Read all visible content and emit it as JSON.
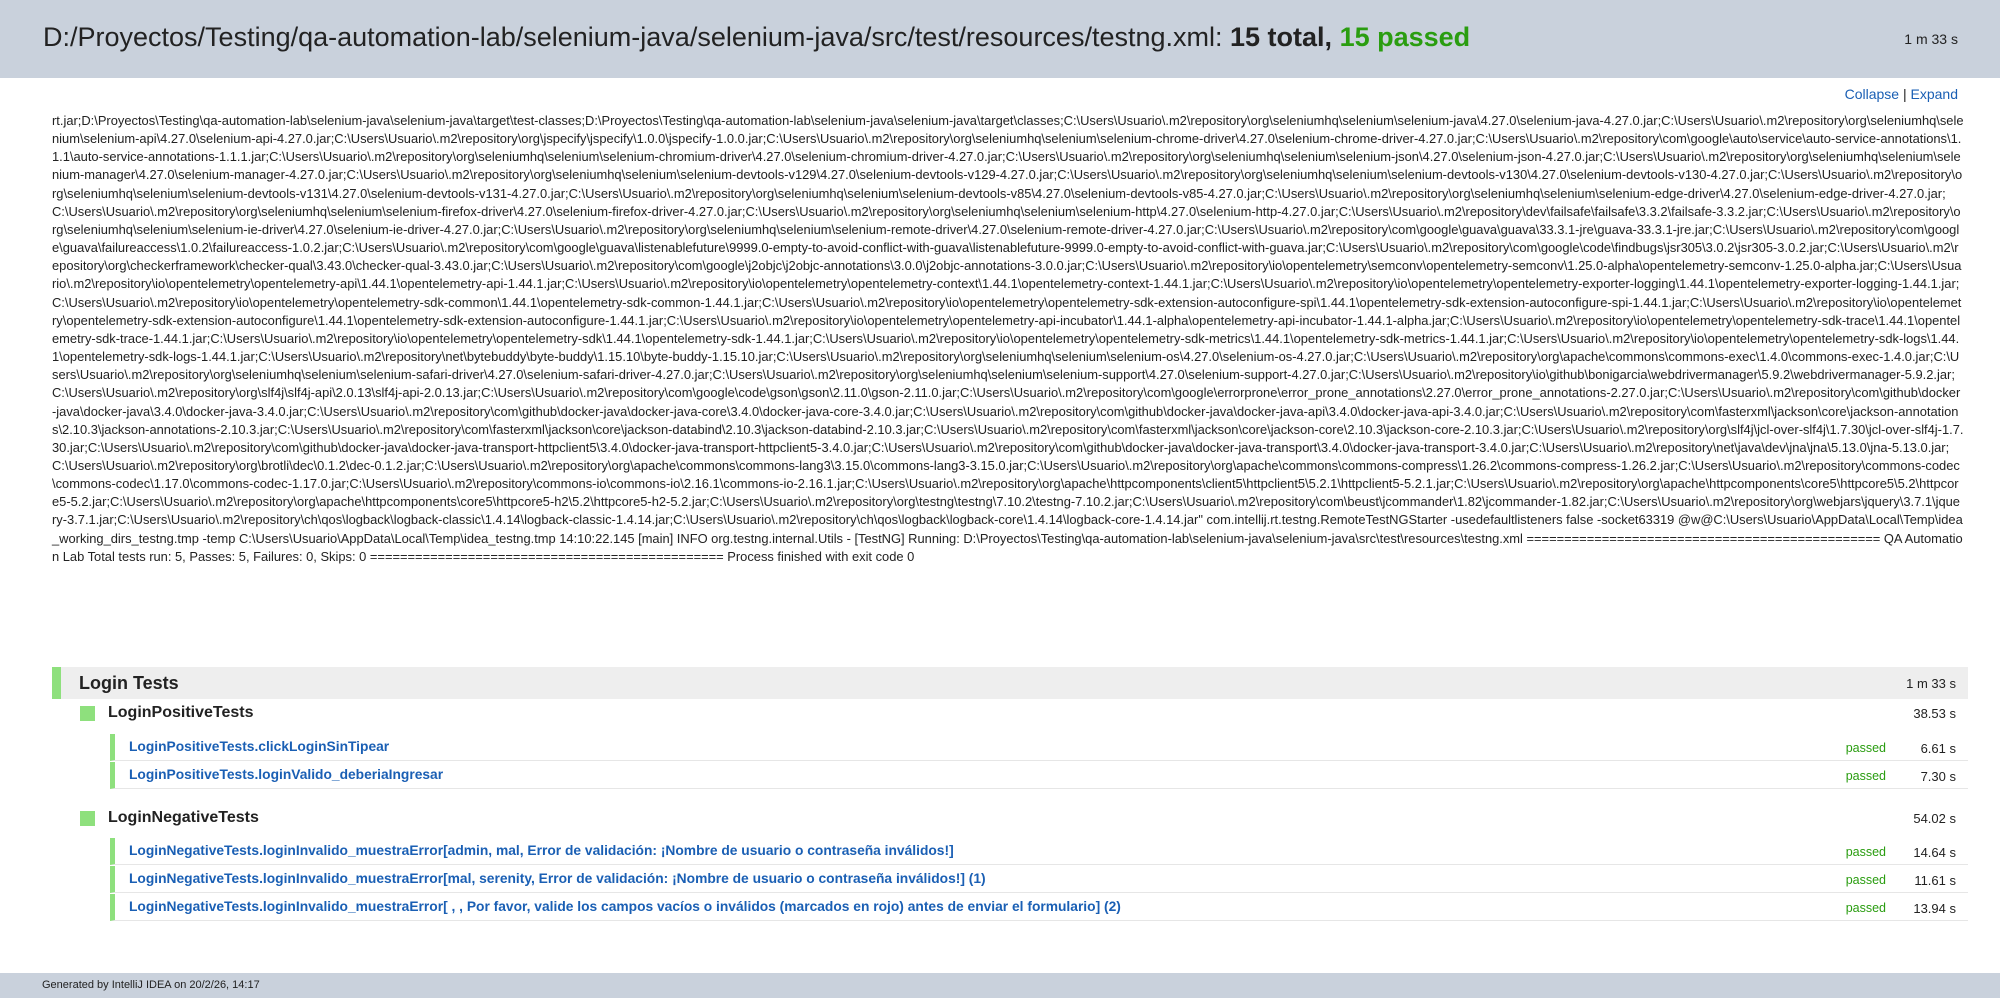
{
  "header": {
    "path": "D:/Proyectos/Testing/qa-automation-lab/selenium-java/selenium-java/src/test/resources/testng.xml:",
    "total": "15 total,",
    "passed": "15 passed",
    "duration": "1 m 33 s"
  },
  "toolbar": {
    "collapse": "Collapse",
    "separator": "|",
    "expand": "Expand"
  },
  "log": "rt.jar;D:\\Proyectos\\Testing\\qa-automation-lab\\selenium-java\\selenium-java\\target\\test-classes;D:\\Proyectos\\Testing\\qa-automation-lab\\selenium-java\\selenium-java\\target\\classes;C:\\Users\\Usuario\\.m2\\repository\\org\\seleniumhq\\selenium\\selenium-java\\4.27.0\\selenium-java-4.27.0.jar;C:\\Users\\Usuario\\.m2\\repository\\org\\seleniumhq\\selenium\\selenium-api\\4.27.0\\selenium-api-4.27.0.jar;C:\\Users\\Usuario\\.m2\\repository\\org\\jspecify\\jspecify\\1.0.0\\jspecify-1.0.0.jar;C:\\Users\\Usuario\\.m2\\repository\\org\\seleniumhq\\selenium\\selenium-chrome-driver\\4.27.0\\selenium-chrome-driver-4.27.0.jar;C:\\Users\\Usuario\\.m2\\repository\\com\\google\\auto\\service\\auto-service-annotations\\1.1.1\\auto-service-annotations-1.1.1.jar;C:\\Users\\Usuario\\.m2\\repository\\org\\seleniumhq\\selenium\\selenium-chromium-driver\\4.27.0\\selenium-chromium-driver-4.27.0.jar;C:\\Users\\Usuario\\.m2\\repository\\org\\seleniumhq\\selenium\\selenium-json\\4.27.0\\selenium-json-4.27.0.jar;C:\\Users\\Usuario\\.m2\\repository\\org\\seleniumhq\\selenium\\selenium-manager\\4.27.0\\selenium-manager-4.27.0.jar;C:\\Users\\Usuario\\.m2\\repository\\org\\seleniumhq\\selenium\\selenium-devtools-v129\\4.27.0\\selenium-devtools-v129-4.27.0.jar;C:\\Users\\Usuario\\.m2\\repository\\org\\seleniumhq\\selenium\\selenium-devtools-v130\\4.27.0\\selenium-devtools-v130-4.27.0.jar;C:\\Users\\Usuario\\.m2\\repository\\org\\seleniumhq\\selenium\\selenium-devtools-v131\\4.27.0\\selenium-devtools-v131-4.27.0.jar;C:\\Users\\Usuario\\.m2\\repository\\org\\seleniumhq\\selenium\\selenium-devtools-v85\\4.27.0\\selenium-devtools-v85-4.27.0.jar;C:\\Users\\Usuario\\.m2\\repository\\org\\seleniumhq\\selenium\\selenium-edge-driver\\4.27.0\\selenium-edge-driver-4.27.0.jar;C:\\Users\\Usuario\\.m2\\repository\\org\\seleniumhq\\selenium\\selenium-firefox-driver\\4.27.0\\selenium-firefox-driver-4.27.0.jar;C:\\Users\\Usuario\\.m2\\repository\\org\\seleniumhq\\selenium\\selenium-http\\4.27.0\\selenium-http-4.27.0.jar;C:\\Users\\Usuario\\.m2\\repository\\dev\\failsafe\\failsafe\\3.3.2\\failsafe-3.3.2.jar;C:\\Users\\Usuario\\.m2\\repository\\org\\seleniumhq\\selenium\\selenium-ie-driver\\4.27.0\\selenium-ie-driver-4.27.0.jar;C:\\Users\\Usuario\\.m2\\repository\\org\\seleniumhq\\selenium\\selenium-remote-driver\\4.27.0\\selenium-remote-driver-4.27.0.jar;C:\\Users\\Usuario\\.m2\\repository\\com\\google\\guava\\guava\\33.3.1-jre\\guava-33.3.1-jre.jar;C:\\Users\\Usuario\\.m2\\repository\\com\\google\\guava\\failureaccess\\1.0.2\\failureaccess-1.0.2.jar;C:\\Users\\Usuario\\.m2\\repository\\com\\google\\guava\\listenablefuture\\9999.0-empty-to-avoid-conflict-with-guava\\listenablefuture-9999.0-empty-to-avoid-conflict-with-guava.jar;C:\\Users\\Usuario\\.m2\\repository\\com\\google\\code\\findbugs\\jsr305\\3.0.2\\jsr305-3.0.2.jar;C:\\Users\\Usuario\\.m2\\repository\\org\\checkerframework\\checker-qual\\3.43.0\\checker-qual-3.43.0.jar;C:\\Users\\Usuario\\.m2\\repository\\com\\google\\j2objc\\j2objc-annotations\\3.0.0\\j2objc-annotations-3.0.0.jar;C:\\Users\\Usuario\\.m2\\repository\\io\\opentelemetry\\semconv\\opentelemetry-semconv\\1.25.0-alpha\\opentelemetry-semconv-1.25.0-alpha.jar;C:\\Users\\Usuario\\.m2\\repository\\io\\opentelemetry\\opentelemetry-api\\1.44.1\\opentelemetry-api-1.44.1.jar;C:\\Users\\Usuario\\.m2\\repository\\io\\opentelemetry\\opentelemetry-context\\1.44.1\\opentelemetry-context-1.44.1.jar;C:\\Users\\Usuario\\.m2\\repository\\io\\opentelemetry\\opentelemetry-exporter-logging\\1.44.1\\opentelemetry-exporter-logging-1.44.1.jar;C:\\Users\\Usuario\\.m2\\repository\\io\\opentelemetry\\opentelemetry-sdk-common\\1.44.1\\opentelemetry-sdk-common-1.44.1.jar;C:\\Users\\Usuario\\.m2\\repository\\io\\opentelemetry\\opentelemetry-sdk-extension-autoconfigure-spi\\1.44.1\\opentelemetry-sdk-extension-autoconfigure-spi-1.44.1.jar;C:\\Users\\Usuario\\.m2\\repository\\io\\opentelemetry\\opentelemetry-sdk-extension-autoconfigure\\1.44.1\\opentelemetry-sdk-extension-autoconfigure-1.44.1.jar;C:\\Users\\Usuario\\.m2\\repository\\io\\opentelemetry\\opentelemetry-api-incubator\\1.44.1-alpha\\opentelemetry-api-incubator-1.44.1-alpha.jar;C:\\Users\\Usuario\\.m2\\repository\\io\\opentelemetry\\opentelemetry-sdk-trace\\1.44.1\\opentelemetry-sdk-trace-1.44.1.jar;C:\\Users\\Usuario\\.m2\\repository\\io\\opentelemetry\\opentelemetry-sdk\\1.44.1\\opentelemetry-sdk-1.44.1.jar;C:\\Users\\Usuario\\.m2\\repository\\io\\opentelemetry\\opentelemetry-sdk-metrics\\1.44.1\\opentelemetry-sdk-metrics-1.44.1.jar;C:\\Users\\Usuario\\.m2\\repository\\io\\opentelemetry\\opentelemetry-sdk-logs\\1.44.1\\opentelemetry-sdk-logs-1.44.1.jar;C:\\Users\\Usuario\\.m2\\repository\\net\\bytebuddy\\byte-buddy\\1.15.10\\byte-buddy-1.15.10.jar;C:\\Users\\Usuario\\.m2\\repository\\org\\seleniumhq\\selenium\\selenium-os\\4.27.0\\selenium-os-4.27.0.jar;C:\\Users\\Usuario\\.m2\\repository\\org\\apache\\commons\\commons-exec\\1.4.0\\commons-exec-1.4.0.jar;C:\\Users\\Usuario\\.m2\\repository\\org\\seleniumhq\\selenium\\selenium-safari-driver\\4.27.0\\selenium-safari-driver-4.27.0.jar;C:\\Users\\Usuario\\.m2\\repository\\org\\seleniumhq\\selenium\\selenium-support\\4.27.0\\selenium-support-4.27.0.jar;C:\\Users\\Usuario\\.m2\\repository\\io\\github\\bonigarcia\\webdrivermanager\\5.9.2\\webdrivermanager-5.9.2.jar;C:\\Users\\Usuario\\.m2\\repository\\org\\slf4j\\slf4j-api\\2.0.13\\slf4j-api-2.0.13.jar;C:\\Users\\Usuario\\.m2\\repository\\com\\google\\code\\gson\\gson\\2.11.0\\gson-2.11.0.jar;C:\\Users\\Usuario\\.m2\\repository\\com\\google\\errorprone\\error_prone_annotations\\2.27.0\\error_prone_annotations-2.27.0.jar;C:\\Users\\Usuario\\.m2\\repository\\com\\github\\docker-java\\docker-java\\3.4.0\\docker-java-3.4.0.jar;C:\\Users\\Usuario\\.m2\\repository\\com\\github\\docker-java\\docker-java-core\\3.4.0\\docker-java-core-3.4.0.jar;C:\\Users\\Usuario\\.m2\\repository\\com\\github\\docker-java\\docker-java-api\\3.4.0\\docker-java-api-3.4.0.jar;C:\\Users\\Usuario\\.m2\\repository\\com\\fasterxml\\jackson\\core\\jackson-annotations\\2.10.3\\jackson-annotations-2.10.3.jar;C:\\Users\\Usuario\\.m2\\repository\\com\\fasterxml\\jackson\\core\\jackson-databind\\2.10.3\\jackson-databind-2.10.3.jar;C:\\Users\\Usuario\\.m2\\repository\\com\\fasterxml\\jackson\\core\\jackson-core\\2.10.3\\jackson-core-2.10.3.jar;C:\\Users\\Usuario\\.m2\\repository\\org\\slf4j\\jcl-over-slf4j\\1.7.30\\jcl-over-slf4j-1.7.30.jar;C:\\Users\\Usuario\\.m2\\repository\\com\\github\\docker-java\\docker-java-transport-httpclient5\\3.4.0\\docker-java-transport-httpclient5-3.4.0.jar;C:\\Users\\Usuario\\.m2\\repository\\com\\github\\docker-java\\docker-java-transport\\3.4.0\\docker-java-transport-3.4.0.jar;C:\\Users\\Usuario\\.m2\\repository\\net\\java\\dev\\jna\\jna\\5.13.0\\jna-5.13.0.jar;C:\\Users\\Usuario\\.m2\\repository\\org\\brotli\\dec\\0.1.2\\dec-0.1.2.jar;C:\\Users\\Usuario\\.m2\\repository\\org\\apache\\commons\\commons-lang3\\3.15.0\\commons-lang3-3.15.0.jar;C:\\Users\\Usuario\\.m2\\repository\\org\\apache\\commons\\commons-compress\\1.26.2\\commons-compress-1.26.2.jar;C:\\Users\\Usuario\\.m2\\repository\\commons-codec\\commons-codec\\1.17.0\\commons-codec-1.17.0.jar;C:\\Users\\Usuario\\.m2\\repository\\commons-io\\commons-io\\2.16.1\\commons-io-2.16.1.jar;C:\\Users\\Usuario\\.m2\\repository\\org\\apache\\httpcomponents\\client5\\httpclient5\\5.2.1\\httpclient5-5.2.1.jar;C:\\Users\\Usuario\\.m2\\repository\\org\\apache\\httpcomponents\\core5\\httpcore5\\5.2\\httpcore5-5.2.jar;C:\\Users\\Usuario\\.m2\\repository\\org\\apache\\httpcomponents\\core5\\httpcore5-h2\\5.2\\httpcore5-h2-5.2.jar;C:\\Users\\Usuario\\.m2\\repository\\org\\testng\\testng\\7.10.2\\testng-7.10.2.jar;C:\\Users\\Usuario\\.m2\\repository\\com\\beust\\jcommander\\1.82\\jcommander-1.82.jar;C:\\Users\\Usuario\\.m2\\repository\\org\\webjars\\jquery\\3.7.1\\jquery-3.7.1.jar;C:\\Users\\Usuario\\.m2\\repository\\ch\\qos\\logback\\logback-classic\\1.4.14\\logback-classic-1.4.14.jar;C:\\Users\\Usuario\\.m2\\repository\\ch\\qos\\logback\\logback-core\\1.4.14\\logback-core-1.4.14.jar\" com.intellij.rt.testng.RemoteTestNGStarter -usedefaultlisteners false -socket63319 @w@C:\\Users\\Usuario\\AppData\\Local\\Temp\\idea_working_dirs_testng.tmp -temp C:\\Users\\Usuario\\AppData\\Local\\Temp\\idea_testng.tmp 14:10:22.145 [main] INFO org.testng.internal.Utils - [TestNG] Running: D:\\Proyectos\\Testing\\qa-automation-lab\\selenium-java\\selenium-java\\src\\test\\resources\\testng.xml =============================================== QA Automation Lab Total tests run: 5, Passes: 5, Failures: 0, Skips: 0 =============================================== Process finished with exit code 0",
  "suite": {
    "name": "Login Tests",
    "duration": "1 m 33 s",
    "classes": [
      {
        "name": "LoginPositiveTests",
        "duration": "38.53 s",
        "tests": [
          {
            "name": "LoginPositiveTests.clickLoginSinTipear",
            "status": "passed",
            "duration": "6.61 s"
          },
          {
            "name": "LoginPositiveTests.loginValido_deberiaIngresar",
            "status": "passed",
            "duration": "7.30 s"
          }
        ]
      },
      {
        "name": "LoginNegativeTests",
        "duration": "54.02 s",
        "tests": [
          {
            "name": "LoginNegativeTests.loginInvalido_muestraError[admin, mal, Error de validación: ¡Nombre de usuario o contraseña inválidos!]",
            "status": "passed",
            "duration": "14.64 s"
          },
          {
            "name": "LoginNegativeTests.loginInvalido_muestraError[mal, serenity, Error de validación: ¡Nombre de usuario o contraseña inválidos!] (1)",
            "status": "passed",
            "duration": "11.61 s"
          },
          {
            "name": "LoginNegativeTests.loginInvalido_muestraError[ , , Por favor, valide los campos vacíos o inválidos (marcados en rojo) antes de enviar el formulario] (2)",
            "status": "passed",
            "duration": "13.94 s"
          }
        ]
      }
    ]
  },
  "footer": {
    "text": "Generated by IntelliJ IDEA on 20/2/26, 14:17"
  },
  "colors": {
    "header_bg": "#c9d1dc",
    "pass_green": "#2a9d10",
    "status_bar": "#8ee07d",
    "link_blue": "#1a5fb4"
  }
}
